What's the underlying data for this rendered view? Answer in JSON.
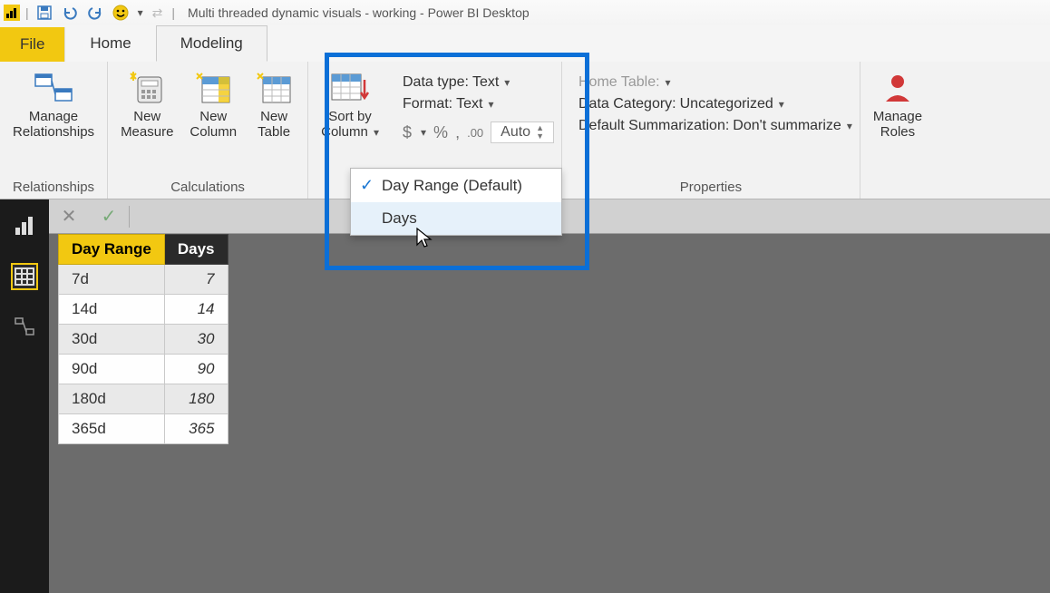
{
  "title": "Multi threaded dynamic visuals - working - Power BI Desktop",
  "tabs": {
    "file": "File",
    "home": "Home",
    "modeling": "Modeling"
  },
  "ribbon": {
    "relationships": {
      "manage": "Manage\nRelationships",
      "group": "Relationships"
    },
    "calculations": {
      "new_measure": "New\nMeasure",
      "new_column": "New\nColumn",
      "new_table": "New\nTable",
      "group": "Calculations"
    },
    "sort": {
      "button": "Sort by\nColumn",
      "menu_default": "Day Range (Default)",
      "menu_days": "Days"
    },
    "format_group": {
      "data_type_label": "Data type:",
      "data_type_value": "Text",
      "format_label": "Format:",
      "format_value": "Text",
      "auto": "Auto"
    },
    "properties": {
      "home_table_label": "Home Table:",
      "data_category_label": "Data Category:",
      "data_category_value": "Uncategorized",
      "summarization_label": "Default Summarization:",
      "summarization_value": "Don't summarize",
      "group": "Properties",
      "manage_roles": "Manage\nRoles"
    }
  },
  "table": {
    "col1": "Day Range",
    "col2": "Days",
    "rows": [
      {
        "range": "7d",
        "days": "7"
      },
      {
        "range": "14d",
        "days": "14"
      },
      {
        "range": "30d",
        "days": "30"
      },
      {
        "range": "90d",
        "days": "90"
      },
      {
        "range": "180d",
        "days": "180"
      },
      {
        "range": "365d",
        "days": "365"
      }
    ]
  }
}
